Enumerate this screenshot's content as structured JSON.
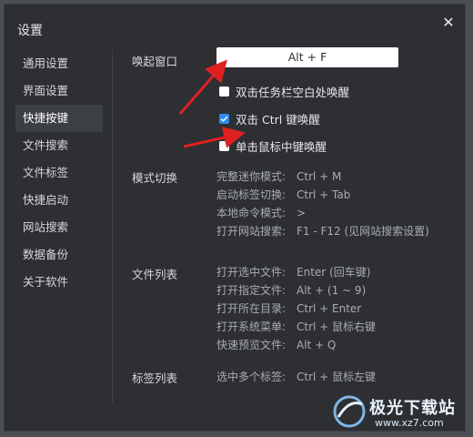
{
  "window": {
    "title": "设置"
  },
  "sidebar": {
    "items": [
      {
        "label": "通用设置"
      },
      {
        "label": "界面设置"
      },
      {
        "label": "快捷按键"
      },
      {
        "label": "文件搜索"
      },
      {
        "label": "文件标签"
      },
      {
        "label": "快捷启动"
      },
      {
        "label": "网站搜索"
      },
      {
        "label": "数据备份"
      },
      {
        "label": "关于软件"
      }
    ],
    "active_index": 2
  },
  "wake": {
    "label": "唤起窗口",
    "hotkey": "Alt + F",
    "options": [
      {
        "label": "双击任务栏空白处唤醒",
        "checked": false
      },
      {
        "label": "双击 Ctrl 键唤醒",
        "checked": true
      },
      {
        "label": "单击鼠标中键唤醒",
        "checked": false
      }
    ]
  },
  "mode_switch": {
    "label": "模式切换",
    "rows": [
      {
        "name": "完整迷你模式:",
        "key": "Ctrl + M"
      },
      {
        "name": "启动标签切换:",
        "key": "Ctrl + Tab"
      },
      {
        "name": "本地命令模式:",
        "key": ">"
      },
      {
        "name": "打开网站搜索:",
        "key": "F1 - F12 (见网站搜索设置)"
      }
    ]
  },
  "file_list": {
    "label": "文件列表",
    "rows": [
      {
        "name": "打开选中文件:",
        "key": "Enter (回车键)"
      },
      {
        "name": "打开指定文件:",
        "key": "Alt + (1 ~ 9)"
      },
      {
        "name": "打开所在目录:",
        "key": "Ctrl + Enter"
      },
      {
        "name": "打开系统菜单:",
        "key": "Ctrl + 鼠标右键"
      },
      {
        "name": "快速预览文件:",
        "key": "Alt + Q"
      }
    ]
  },
  "tag_list": {
    "label": "标签列表",
    "rows": [
      {
        "name": "选中多个标签:",
        "key": "Ctrl + 鼠标左键"
      }
    ]
  },
  "watermark": {
    "brand": "极光下载站",
    "url": "www.xz7.com"
  },
  "colors": {
    "dialog_bg": "#2d2f33",
    "backdrop": "#4b4e54",
    "accent": "#2d8cf0",
    "arrow": "#e02020"
  }
}
